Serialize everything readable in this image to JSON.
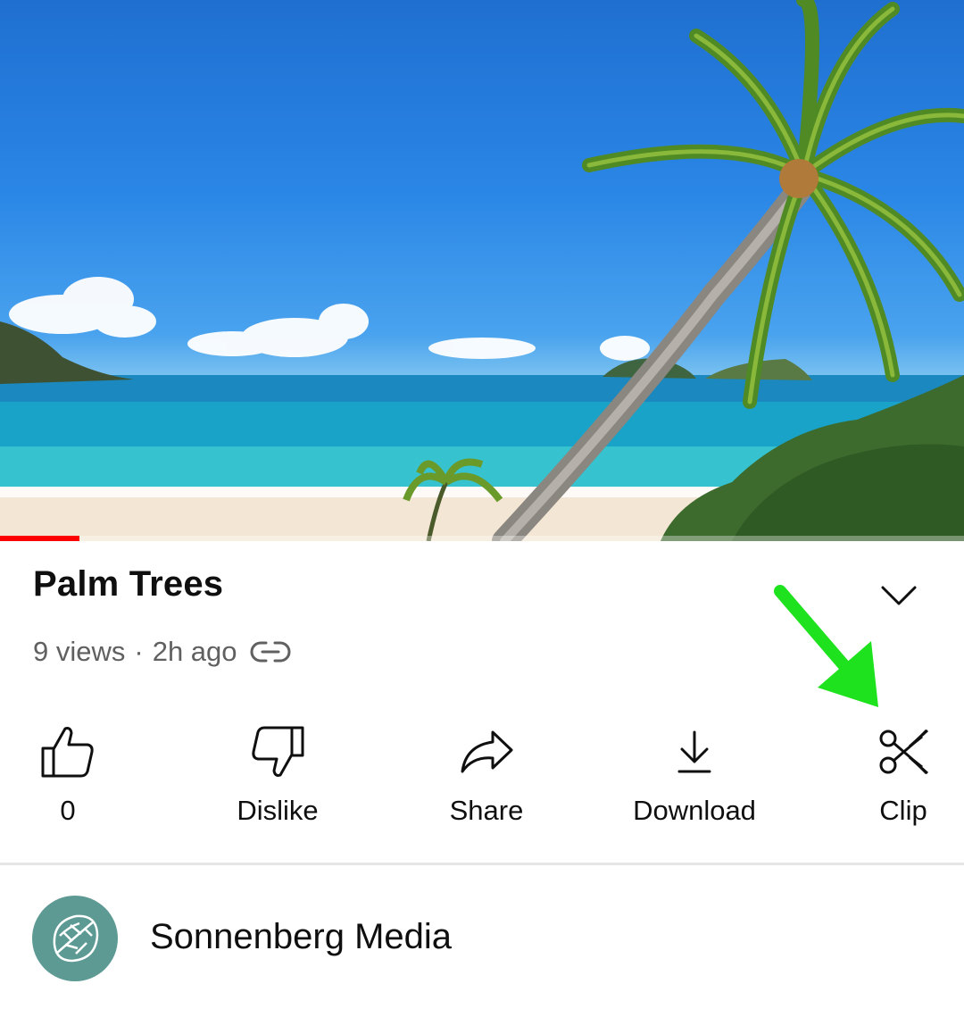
{
  "video": {
    "progress_fraction": 0.082,
    "progress_color": "#ff0000"
  },
  "title": "Palm Trees",
  "meta": {
    "views": "9 views",
    "separator": "·",
    "age": "2h ago",
    "icon": "link-icon"
  },
  "expand_icon": "chevron-down-icon",
  "actions": {
    "like": {
      "label": "0",
      "icon": "thumbs-up-icon"
    },
    "dislike": {
      "label": "Dislike",
      "icon": "thumbs-down-icon"
    },
    "share": {
      "label": "Share",
      "icon": "share-arrow-icon"
    },
    "download": {
      "label": "Download",
      "icon": "download-icon"
    },
    "clip": {
      "label": "Clip",
      "icon": "scissors-icon"
    }
  },
  "annotation": {
    "color": "#1fe21f",
    "points_to": "clip"
  },
  "channel": {
    "name": "Sonnenberg Media",
    "avatar_color": "#5e9a94",
    "avatar_icon": "leaf-logo-icon"
  }
}
